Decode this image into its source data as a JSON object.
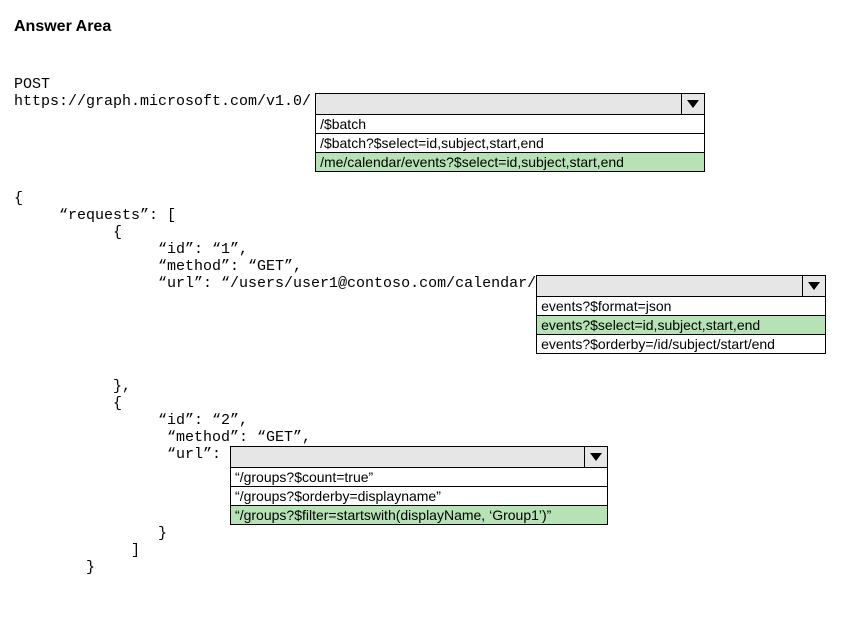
{
  "title": "Answer Area",
  "post_label": "POST",
  "url_prefix": "https://graph.microsoft.com/v1.0/",
  "dropdown1": {
    "options": [
      "/$batch",
      "/$batch?$select=id,subject,start,end",
      "/me/calendar/events?$select=id,subject,start,end"
    ],
    "highlight_index": 2
  },
  "code": {
    "brace_open": "{",
    "requests_line": "     “requests”: [",
    "obj1_open": "           {",
    "id1_line": "                “id”: “1”,",
    "method1_line": "                “method”: “GET”,",
    "url1_prefix": "                “url”: “/users/user1@contoso.com/calendar/",
    "obj1_close": "           },",
    "obj2_open": "           {",
    "id2_line": "                “id”: “2”,",
    "method2_line": "                 “method”: “GET”,",
    "url2_prefix": "                 “url”: ",
    "obj2_close_inner": "                }",
    "arr_close": "             ]",
    "brace_close": "        }"
  },
  "dropdown2": {
    "options": [
      "events?$format=json",
      "events?$select=id,subject,start,end",
      "events?$orderby=/id/subject/start/end"
    ],
    "highlight_index": 1
  },
  "dropdown3": {
    "options": [
      "“/groups?$count=true”",
      "“/groups?$orderby=displayname”",
      "“/groups?$filter=startswith(displayName, ‘Group1’)”"
    ],
    "highlight_index": 2
  }
}
